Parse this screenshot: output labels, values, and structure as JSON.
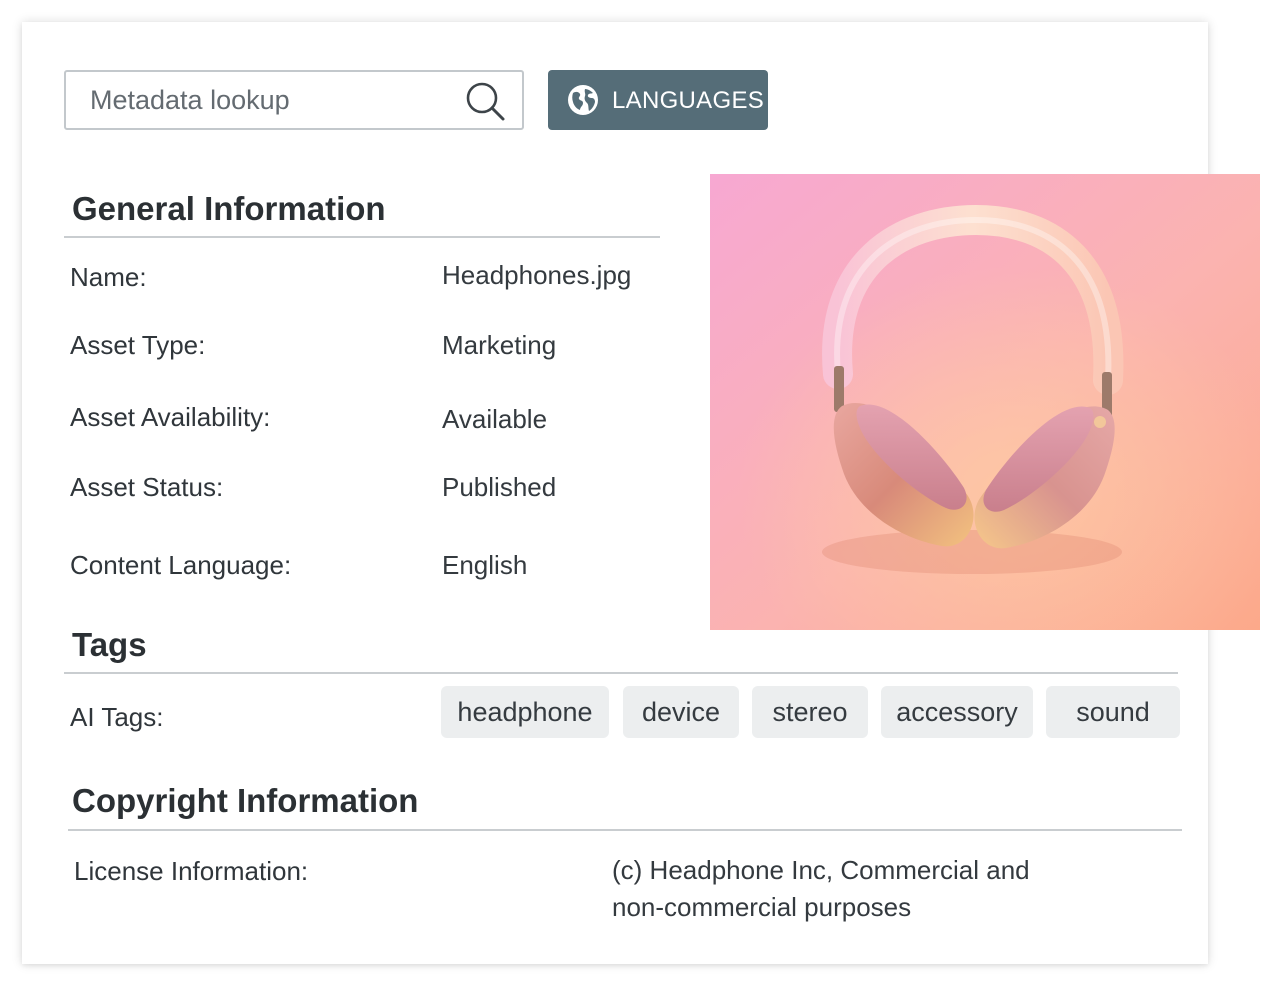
{
  "search": {
    "placeholder": "Metadata lookup",
    "icon": "search-icon"
  },
  "languages_button": {
    "label": "LANGUAGES",
    "icon": "globe-icon",
    "color": "#556d78"
  },
  "general": {
    "title": "General Information",
    "fields": [
      {
        "label": "Name:",
        "value": "Headphones.jpg"
      },
      {
        "label": "Asset Type:",
        "value": "Marketing"
      },
      {
        "label": "Asset Availability:",
        "value": "Available"
      },
      {
        "label": "Asset Status:",
        "value": "Published"
      },
      {
        "label": "Content Language:",
        "value": "English"
      }
    ]
  },
  "preview": {
    "subject": "headphones-photo",
    "background_colors": [
      "#f7a9cf",
      "#fbb39a"
    ]
  },
  "tags": {
    "title": "Tags",
    "ai_label": "AI Tags:",
    "items": [
      "headphone",
      "device",
      "stereo",
      "accessory",
      "sound"
    ]
  },
  "copyright": {
    "title": "Copyright Information",
    "license_label": "License Information:",
    "license_line1": "(c) Headphone Inc, Commercial and",
    "license_line2": "non-commercial purposes"
  }
}
